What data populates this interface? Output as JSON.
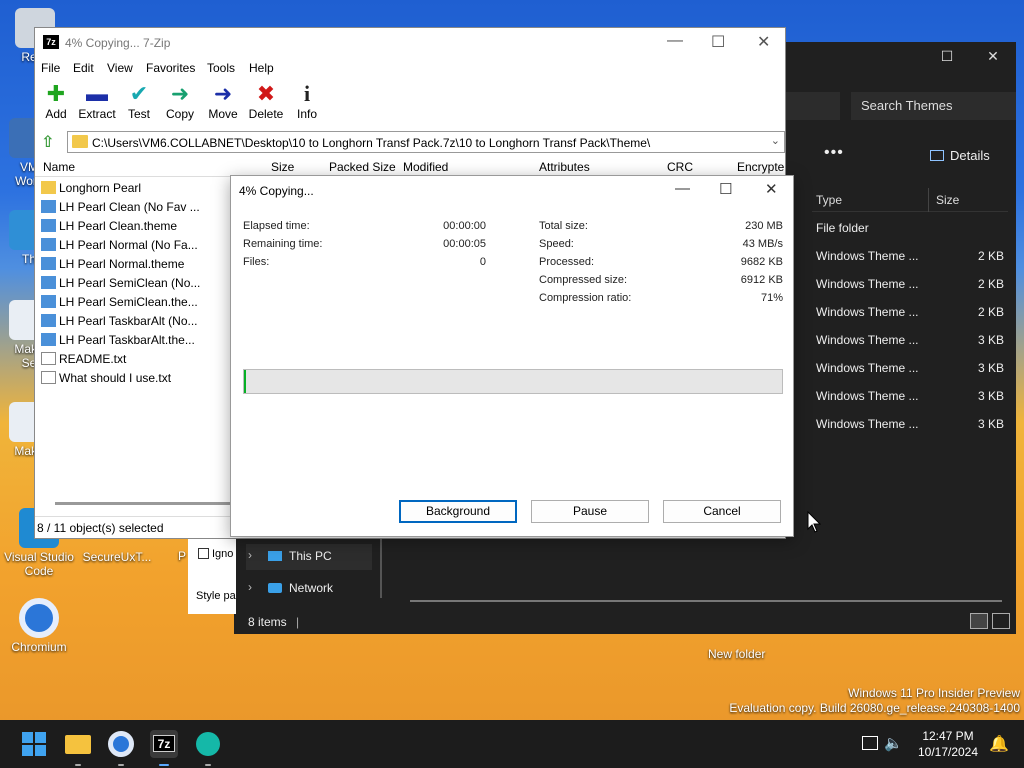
{
  "desktop": {
    "icons": [
      {
        "label": "Recy"
      },
      {
        "label": "VM"
      },
      {
        "label": "Work"
      },
      {
        "label": "Th"
      },
      {
        "label": "Maku"
      },
      {
        "label": "Se"
      },
      {
        "label": "Maku"
      },
      {
        "label": "Visual Studio Code"
      },
      {
        "label": "SecureUxT..."
      },
      {
        "label": "Chromium"
      },
      {
        "label": "P"
      },
      {
        "label": "New folder"
      }
    ],
    "watermark_line1": "Windows 11 Pro Insider Preview",
    "watermark_line2": "Evaluation copy. Build 26080.ge_release.240308-1400"
  },
  "explorer": {
    "search_placeholder": "Search Themes",
    "more_label": "•••",
    "details_label": "Details",
    "col_type": "Type",
    "col_size": "Size",
    "rows": [
      {
        "type": "File folder",
        "size": ""
      },
      {
        "type": "Windows Theme ...",
        "size": "2 KB"
      },
      {
        "type": "Windows Theme ...",
        "size": "2 KB"
      },
      {
        "type": "Windows Theme ...",
        "size": "2 KB"
      },
      {
        "type": "Windows Theme ...",
        "size": "3 KB"
      },
      {
        "type": "Windows Theme ...",
        "size": "3 KB"
      },
      {
        "type": "Windows Theme ...",
        "size": "3 KB"
      },
      {
        "type": "Windows Theme ...",
        "size": "3 KB"
      }
    ],
    "side_this_pc": "This PC",
    "side_network": "Network",
    "status": "8 items",
    "panel_ign": "Igno",
    "panel_style": "Style pa"
  },
  "zip": {
    "title": "4% Copying... 7-Zip",
    "menu": [
      "File",
      "Edit",
      "View",
      "Favorites",
      "Tools",
      "Help"
    ],
    "toolbar": {
      "add": "Add",
      "extract": "Extract",
      "test": "Test",
      "copy": "Copy",
      "move": "Move",
      "delete": "Delete",
      "info": "Info"
    },
    "path": "C:\\Users\\VM6.COLLABNET\\Desktop\\10 to Longhorn Transf Pack.7z\\10 to Longhorn Transf Pack\\Theme\\",
    "columns": [
      "Name",
      "Size",
      "Packed Size",
      "Modified",
      "Attributes",
      "CRC",
      "Encrypte"
    ],
    "files": [
      {
        "name": "Longhorn Pearl",
        "kind": "folder"
      },
      {
        "name": "LH Pearl Clean (No Fav ...",
        "kind": "theme"
      },
      {
        "name": "LH Pearl Clean.theme",
        "kind": "theme"
      },
      {
        "name": "LH Pearl Normal (No Fa...",
        "kind": "theme"
      },
      {
        "name": "LH Pearl Normal.theme",
        "kind": "theme"
      },
      {
        "name": "LH Pearl SemiClean (No...",
        "kind": "theme"
      },
      {
        "name": "LH Pearl SemiClean.the...",
        "kind": "theme"
      },
      {
        "name": "LH Pearl TaskbarAlt (No...",
        "kind": "theme"
      },
      {
        "name": "LH Pearl TaskbarAlt.the...",
        "kind": "theme"
      },
      {
        "name": "README.txt",
        "kind": "txt"
      },
      {
        "name": "What should I use.txt",
        "kind": "txt"
      }
    ],
    "status": "8 / 11 object(s) selected"
  },
  "dialog": {
    "title": "4% Copying...",
    "left_stats": [
      {
        "label": "Elapsed time:",
        "value": "00:00:00"
      },
      {
        "label": "Remaining time:",
        "value": "00:00:05"
      },
      {
        "label": "Files:",
        "value": "0"
      }
    ],
    "right_stats": [
      {
        "label": "Total size:",
        "value": "230 MB"
      },
      {
        "label": "Speed:",
        "value": "43 MB/s"
      },
      {
        "label": "Processed:",
        "value": "9682 KB"
      },
      {
        "label": "Compressed size:",
        "value": "6912 KB"
      },
      {
        "label": "Compression ratio:",
        "value": "71%"
      }
    ],
    "progress": 0.004,
    "buttons": {
      "background": "Background",
      "pause": "Pause",
      "cancel": "Cancel"
    }
  },
  "taskbar": {
    "time": "12:47 PM",
    "date": "10/17/2024"
  },
  "colors": {
    "progress_fill": "#06b025",
    "explorer_bg": "#202020",
    "taskbar_bg": "#1c1c1c"
  }
}
